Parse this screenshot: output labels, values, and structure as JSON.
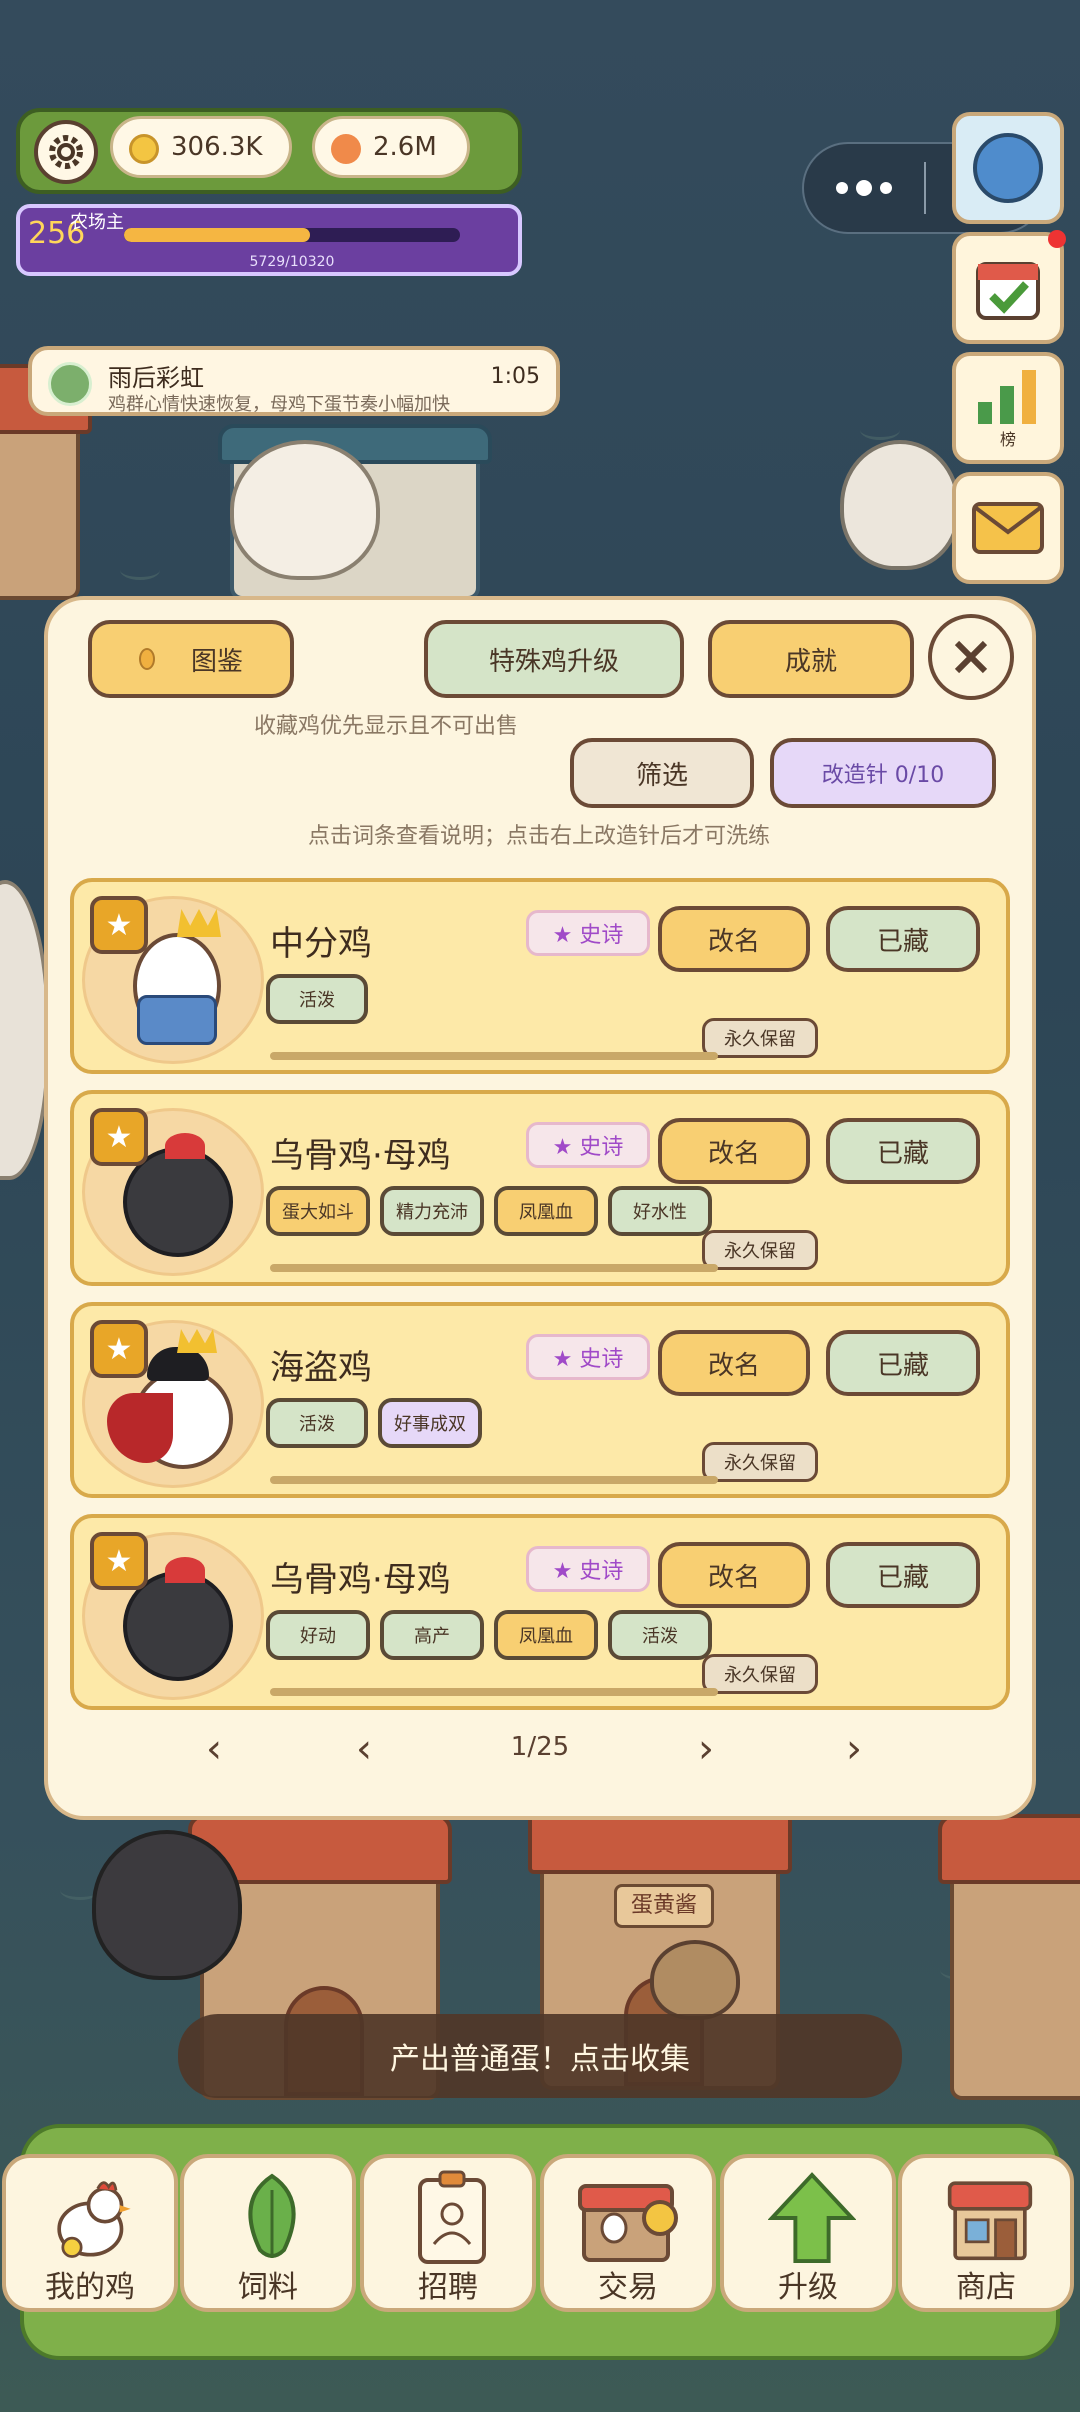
{
  "hud": {
    "coins": "306.3K",
    "eggs": "2.6M",
    "level": "256",
    "title": "农场主",
    "xp_text": "5729/10320",
    "xp_progress": 0.555
  },
  "side_buttons": {
    "rank_label": "榜"
  },
  "weather": {
    "title": "雨后彩虹",
    "desc": "鸡群心情快速恢复，母鸡下蛋节奏小幅加快",
    "time": "1:05"
  },
  "bg_signs": {
    "house_mid": "蛋黄酱"
  },
  "dialog": {
    "tabs": {
      "catalog": "图鉴",
      "special_upgrade": "特殊鸡升级",
      "achievement": "成就"
    },
    "note_collect": "收藏鸡优先显示且不可出售",
    "filter": "筛选",
    "needle": "改造针 0/10",
    "note_tip": "点击词条查看说明；点击右上改造针后才可洗练",
    "rename_label": "改名",
    "stored_label": "已藏",
    "epic_label": "★ 史诗",
    "keep_label": "永久保留",
    "chickens": [
      {
        "name": "中分鸡",
        "tags": [
          {
            "text": "活泼",
            "color": "green"
          }
        ]
      },
      {
        "name": "乌骨鸡·母鸡",
        "tags": [
          {
            "text": "蛋大如斗",
            "color": "yellow"
          },
          {
            "text": "精力充沛",
            "color": "green"
          },
          {
            "text": "凤凰血",
            "color": "yellow"
          },
          {
            "text": "好水性",
            "color": "green"
          }
        ]
      },
      {
        "name": "海盗鸡",
        "tags": [
          {
            "text": "活泼",
            "color": "green"
          },
          {
            "text": "好事成双",
            "color": "purple"
          }
        ]
      },
      {
        "name": "乌骨鸡·母鸡",
        "tags": [
          {
            "text": "好动",
            "color": "green"
          },
          {
            "text": "高产",
            "color": "green"
          },
          {
            "text": "凤凰血",
            "color": "yellow"
          },
          {
            "text": "活泼",
            "color": "green"
          }
        ]
      }
    ],
    "pager": {
      "first": "‹",
      "prev": "‹",
      "page": "1/25",
      "next": "›",
      "last": "›"
    }
  },
  "toast": "产出普通蛋！点击收集",
  "nav": [
    {
      "label": "我的鸡",
      "icon": "chicken-icon"
    },
    {
      "label": "饲料",
      "icon": "leaf-icon"
    },
    {
      "label": "招聘",
      "icon": "badge-icon"
    },
    {
      "label": "交易",
      "icon": "shop-stall-icon"
    },
    {
      "label": "升级",
      "icon": "arrow-up-icon"
    },
    {
      "label": "商店",
      "icon": "store-icon"
    }
  ],
  "colors": {
    "card_bg": "#fde9a8",
    "dialog_bg": "#fdf5df",
    "accent_yellow": "#f8cf72",
    "epic_purple": "#a04ac8",
    "hud_green": "#6c9a3c",
    "xp_purple": "#6b3fa0"
  }
}
